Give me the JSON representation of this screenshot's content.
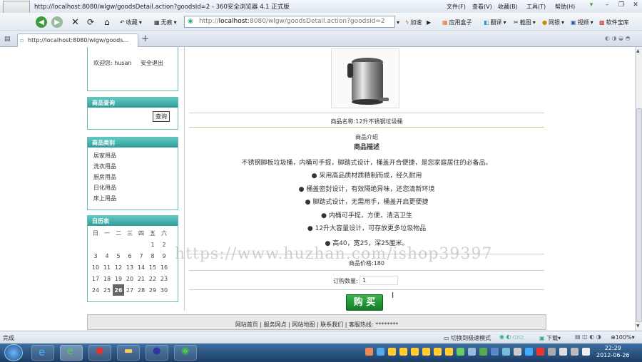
{
  "window": {
    "title": "http://localhost:8080/wlgw/goodsDetail.action?goodsId=2 - 360安全浏览器 4.1 正式版",
    "menus": [
      "文件(F)",
      "查看(V)",
      "收藏(B)",
      "工具(T)",
      "帮助(H)"
    ]
  },
  "toolbar": {
    "favorites": "收藏",
    "untraced": "无痕",
    "address_host": "localhost",
    "address_prefix": "http://",
    "address_rest": ":8080/wlgw/goodsDetail.action?goodsId=2",
    "speedup": "加速",
    "apps": "应用盒子",
    "translate": "翻译",
    "screenshot": "截图",
    "netbank": "网银",
    "video": "视频",
    "software": "软件宝库"
  },
  "tab": {
    "label": "http://localhost:8080/wlgw/goods..."
  },
  "sidebar": {
    "welcome": "欢迎您:",
    "username": "husan",
    "logout": "安全退出",
    "search_title": "商品查询",
    "search_button": "查询",
    "category_title": "商品类别",
    "categories": [
      "居家用品",
      "洗衣用品",
      "厨房用品",
      "日化用品",
      "床上用品"
    ],
    "calendar_title": "日历表",
    "weekdays": [
      "日",
      "一",
      "二",
      "三",
      "四",
      "五",
      "六"
    ],
    "weeks": [
      [
        "",
        "",
        "",
        "",
        "",
        "1",
        "2"
      ],
      [
        "3",
        "4",
        "5",
        "6",
        "7",
        "8",
        "9"
      ],
      [
        "10",
        "11",
        "12",
        "13",
        "14",
        "15",
        "16"
      ],
      [
        "17",
        "18",
        "19",
        "20",
        "21",
        "22",
        "23"
      ],
      [
        "24",
        "25",
        "26",
        "27",
        "28",
        "29",
        "30"
      ]
    ],
    "today": "26"
  },
  "product": {
    "name_label": "商品名称:",
    "name": "12升不锈钢垃圾桶",
    "intro_label": "商品介绍",
    "desc_title": "商品描述",
    "desc": "不锈钢脚板垃圾桶，内桶可手提，脚踏式设计，桶盖开合便捷，是您家庭居住的必备品。",
    "features": [
      "● 采用高品质材质精制而成，经久耐用",
      "● 桶盖密封设计，有效隔绝异味，还您清新环境",
      "● 脚踏式设计，无需用手，桶盖开启更便捷",
      "● 内桶可手提，方便，清洁卫生",
      "● 12升大容量设计，可存放更多垃圾物品",
      "● 高40，宽25，深25厘米。"
    ],
    "price_label": "商品价格:",
    "price": "180",
    "qty_label": "订购数量:",
    "qty": "1",
    "buy_button": "购 买"
  },
  "footer": {
    "links": [
      "网站首页",
      "服务网点",
      "网站地图",
      "联系我们",
      "客服热线:"
    ],
    "phone": "********"
  },
  "watermark": "https://www.huzhan.com/ishop39397",
  "status": {
    "text": "完成",
    "mode": "切换到极速模式",
    "download": "下载",
    "zoom": "100%"
  },
  "clock": {
    "time": "22:29",
    "date": "2012-06-26"
  },
  "colors": {
    "panel_header": "#3fb0ab",
    "buy_green": "#1e8c32"
  }
}
